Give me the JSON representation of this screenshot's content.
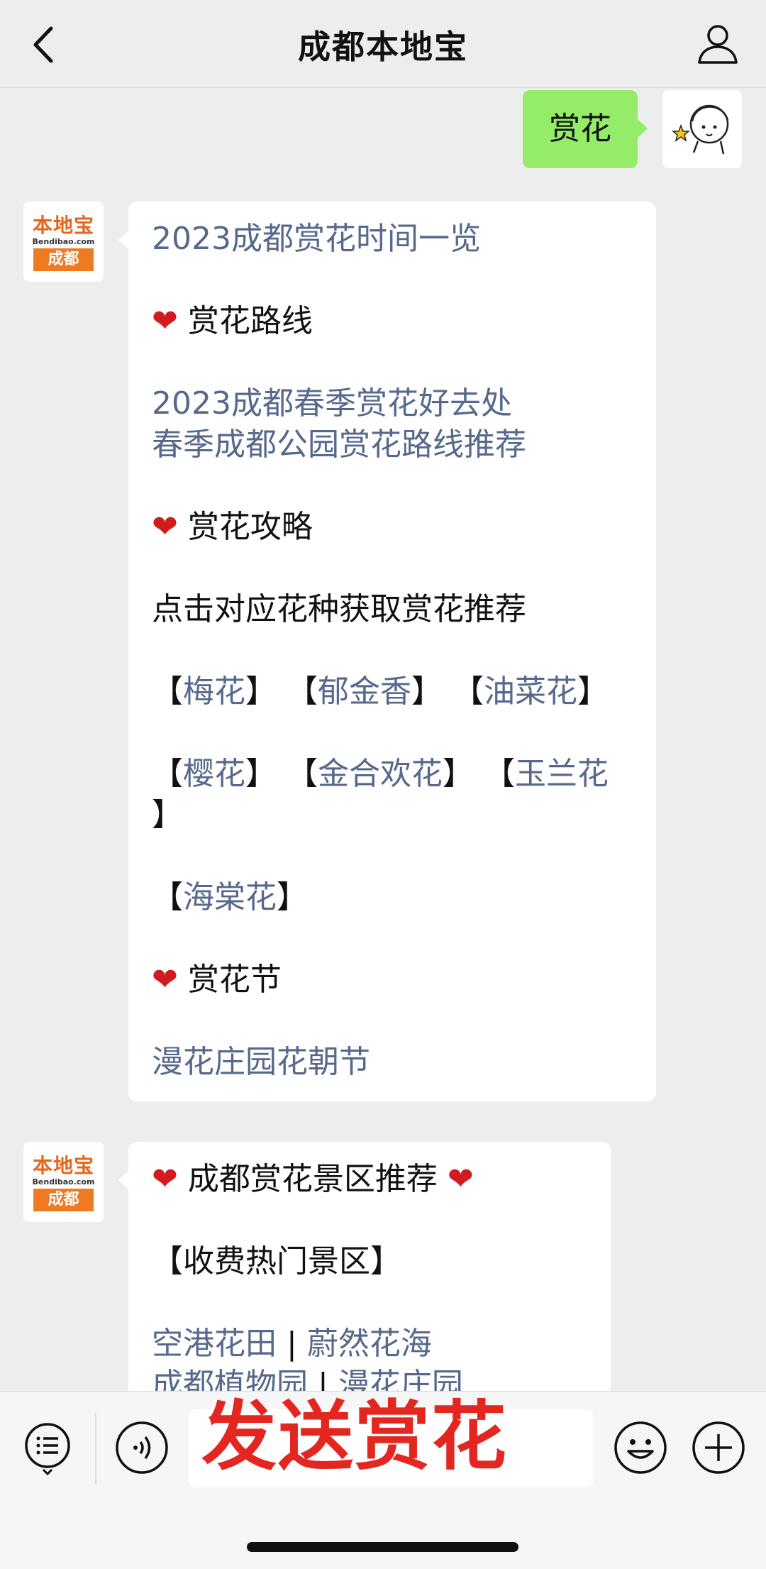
{
  "header": {
    "title": "成都本地宝"
  },
  "self_message": {
    "text": "赏花"
  },
  "bot_avatar": {
    "top": "本地宝",
    "mid": "Bendibao.com",
    "bottom": "成都"
  },
  "bubble1": {
    "title_link": "2023成都赏花时间一览",
    "route_heading": "赏花路线",
    "route_link1": "2023成都春季赏花好去处",
    "route_link2": "春季成都公园赏花路线推荐",
    "guide_heading": "赏花攻略",
    "guide_text": "点击对应花种获取赏花推荐",
    "flowers": [
      "梅花",
      "郁金香",
      "油菜花",
      "樱花",
      "金合欢花",
      "玉兰花",
      "海棠花"
    ],
    "festival_heading": "赏花节",
    "festival_link": "漫花庄园花朝节"
  },
  "bubble2": {
    "heading": "成都赏花景区推荐",
    "section": "【收费热门景区】",
    "spots": [
      "空港花田",
      "蔚然花海",
      "成都植物园",
      "漫花庄园"
    ],
    "separator": "|"
  },
  "overlay_text": "发送赏花",
  "icons": {
    "back": "chevron-left-icon",
    "profile": "person-icon",
    "menu": "list-menu-icon",
    "voice": "voice-icon",
    "emoji": "smiley-icon",
    "add": "plus-circle-icon",
    "heart": "heart-icon"
  },
  "colors": {
    "link": "#56698c",
    "self_bubble": "#95ec69",
    "overlay": "#e42620",
    "heart": "#d11b1f"
  }
}
